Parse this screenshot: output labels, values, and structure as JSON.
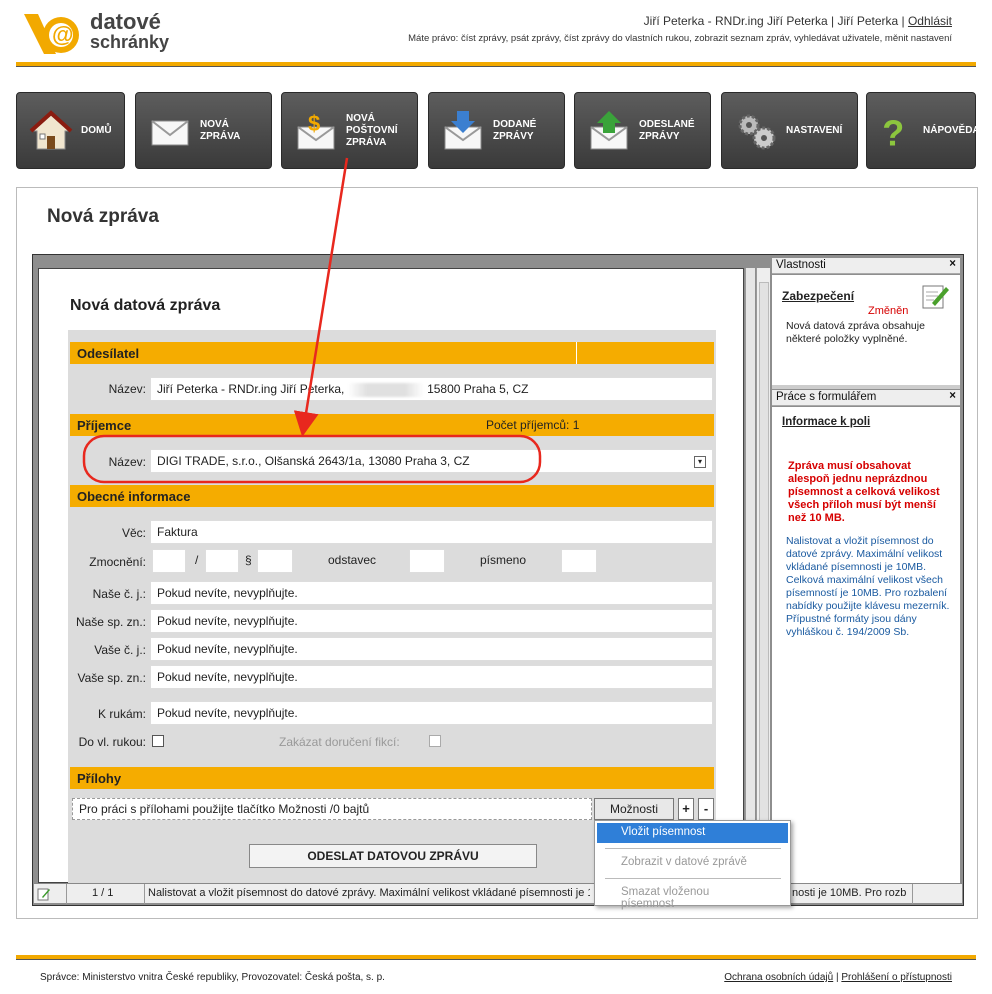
{
  "header": {
    "logo_text_1": "datové",
    "logo_text_2": "schránky",
    "user": "Jiří Peterka - RNDr.ing Jiří Peterka | Jiří Peterka | ",
    "logout": "Odhlásit",
    "rights": "Máte právo: číst zprávy, psát zprávy, číst zprávy do vlastních rukou, zobrazit seznam zpráv, vyhledávat uživatele, měnit nastavení"
  },
  "nav": {
    "home": "DOMŮ",
    "new_1": "NOVÁ",
    "new_2": "ZPRÁVA",
    "postal_1": "NOVÁ",
    "postal_2": "POŠTOVNÍ",
    "postal_3": "ZPRÁVA",
    "received_1": "DODANÉ",
    "received_2": "ZPRÁVY",
    "sent_1": "ODESLANÉ",
    "sent_2": "ZPRÁVY",
    "settings": "NASTAVENÍ",
    "help": "NÁPOVĚDA"
  },
  "page_title": "Nová zpráva",
  "form": {
    "title": "Nová datová zpráva",
    "sender_section": "Odesílatel",
    "name_label": "Název:",
    "sender_name_a": "Jiří Peterka - RNDr.ing Jiří Peterka,",
    "sender_name_b": "15800 Praha 5, CZ",
    "recipient_section": "Příjemce",
    "recipient_count": "Počet příjemců: 1",
    "recipient_name": "DIGI TRADE, s.r.o., Olšanská 2643/1a, 13080 Praha 3, CZ",
    "general_section": "Obecné informace",
    "subject_label": "Věc:",
    "subject_value": "Faktura",
    "auth_label": "Zmocnění:",
    "slash": "/",
    "paragraph_sign": "§",
    "odstavec_label": "odstavec",
    "pismeno_label": "písmeno",
    "our_ref_label": "Naše č. j.:",
    "our_file_label": "Naše sp. zn.:",
    "your_ref_label": "Vaše č. j.:",
    "your_file_label": "Vaše sp. zn.:",
    "attn_label": "K rukám:",
    "placeholder": "Pokud nevíte, nevyplňujte.",
    "personal_label": "Do vl. rukou:",
    "fiction_label": "Zakázat doručení fikcí:",
    "attachments_section": "Přílohy",
    "attachments_hint": "Pro práci s přílohami použijte tlačítko Možnosti /0 bajtů",
    "options_button": "Možnosti",
    "plus": "+",
    "minus": "-",
    "send_button": "ODESLAT DATOVOU ZPRÁVU"
  },
  "menu": {
    "insert": "Vložit písemnost",
    "show": "Zobrazit v datové zprávě",
    "delete": "Smazat vloženou písemnost"
  },
  "properties": {
    "title": "Vlastnosti",
    "close": "×",
    "security": "Zabezpečení",
    "changed": "Změněn",
    "desc": "Nová datová zpráva obsahuje některé položky vyplněné."
  },
  "form_work": {
    "title": "Práce s formulářem",
    "close": "×",
    "field_info": "Informace k poli",
    "warning": "Zpráva musí obsahovat alespoň jednu neprázdnou písemnost a celková velikost všech příloh musí být menší než 10 MB.",
    "help": "Nalistovat a vložit písemnost do datové zprávy. Maximální velikost vkládané písemnosti je 10MB. Celková maximální velikost všech písemností je 10MB. Pro rozbalení nabídky použijte klávesu mezerník. Přípustné formáty jsou dány vyhláškou č. 194/2009 Sb."
  },
  "status": {
    "page": "1 / 1",
    "text": "Nalistovat a vložit písemnost do datové zprávy. Maximální velikost vkládané písemnosti je 10M",
    "text_tail": "nosti je 10MB. Pro rozb"
  },
  "footer": {
    "admin": "Správce: Ministerstvo vnitra České republiky, Provozovatel: Česká pošta, s. p.",
    "privacy": "Ochrana osobních údajů",
    "sep": " | ",
    "access": "Prohlášení o přístupnosti"
  },
  "colors": {
    "accent": "#f5ac00",
    "annotation": "#e8281e",
    "help_text": "#1a5aa0",
    "warning": "#d60000"
  }
}
